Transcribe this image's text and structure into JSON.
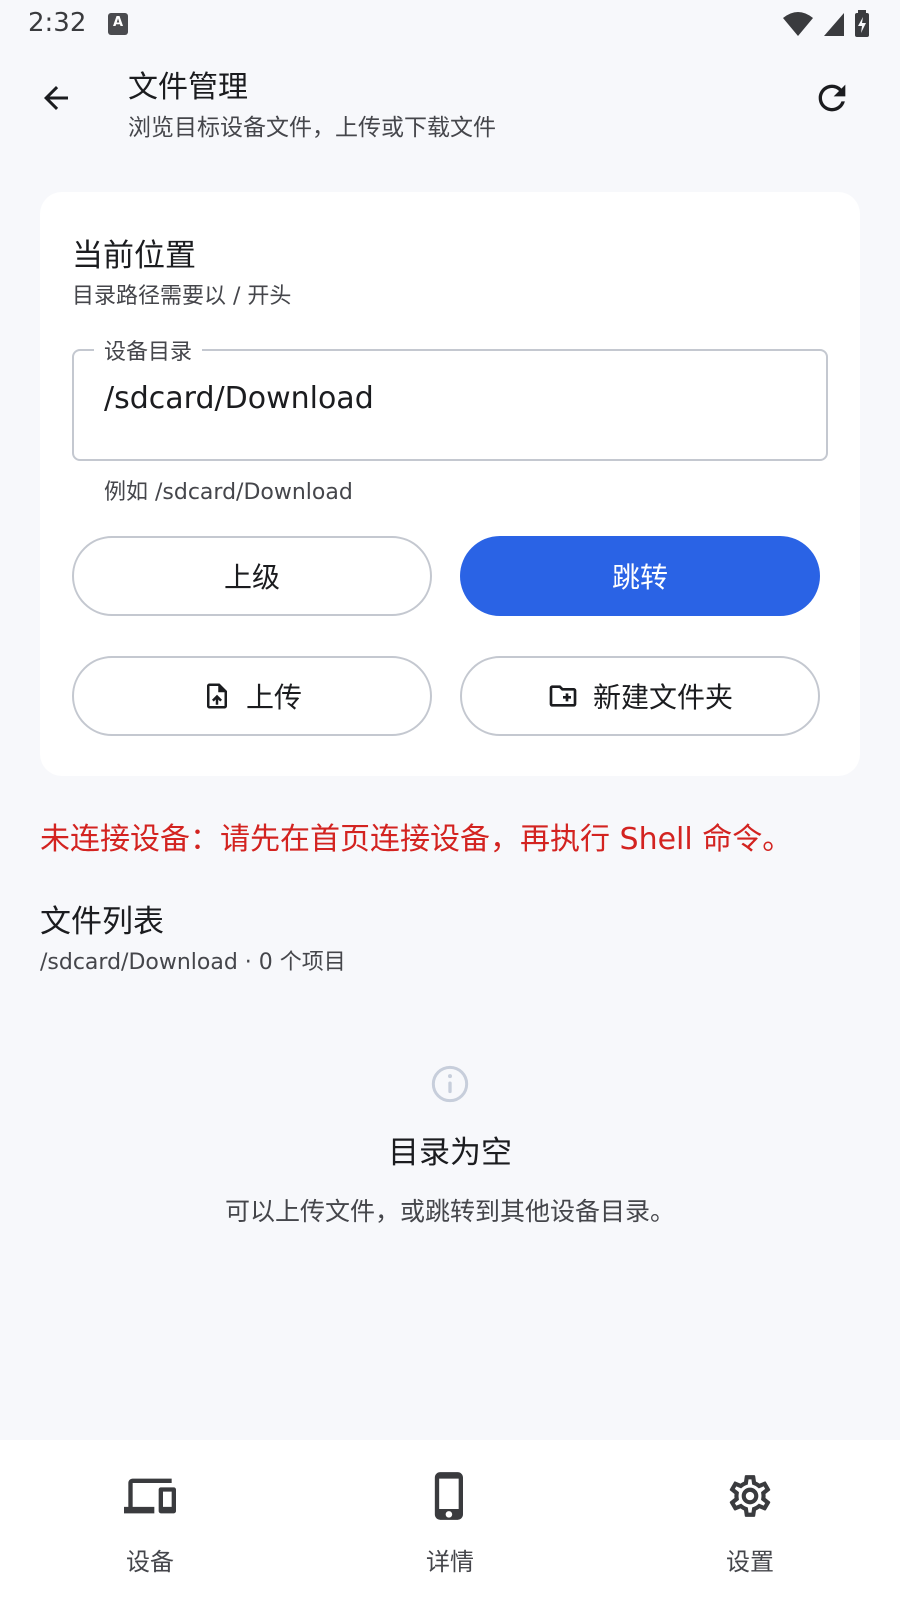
{
  "status_bar": {
    "time": "2:32",
    "notification_glyph": "A"
  },
  "app_bar": {
    "title": "文件管理",
    "subtitle": "浏览目标设备文件，上传或下载文件"
  },
  "location_card": {
    "title": "当前位置",
    "subtitle": "目录路径需要以 / 开头",
    "field_label": "设备目录",
    "field_value": "/sdcard/Download",
    "field_help": "例如 /sdcard/Download",
    "buttons": {
      "up": "上级",
      "go": "跳转",
      "upload": "上传",
      "new_folder": "新建文件夹"
    }
  },
  "error_message": "未连接设备：请先在首页连接设备，再执行 Shell 命令。",
  "file_list": {
    "title": "文件列表",
    "meta": "/sdcard/Download · 0 个项目"
  },
  "empty_state": {
    "title": "目录为空",
    "description": "可以上传文件，或跳转到其他设备目录。"
  },
  "bottom_nav": {
    "items": [
      {
        "label": "设备",
        "icon": "devices-icon"
      },
      {
        "label": "详情",
        "icon": "phone-icon"
      },
      {
        "label": "设置",
        "icon": "gear-icon"
      }
    ]
  },
  "colors": {
    "accent": "#2a63e5",
    "error": "#d32320",
    "background": "#f7f8fb",
    "card": "#ffffff"
  }
}
